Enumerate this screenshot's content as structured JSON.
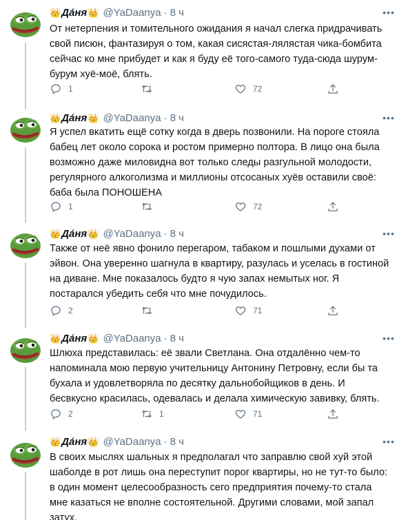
{
  "tweets": [
    {
      "name": "Да́ня",
      "handle": "@YaDaanya",
      "time": "8 ч",
      "crown_left": "👑",
      "crown_right": "👑",
      "more_icon": "ellipsis-icon",
      "text": "От нетерпения и томительного ожидания я начал слегка придрачивать\nсвой писюн, фантазируя о том, какая сисястая-лялястая чика-бомбита\nсейчас ко мне прибудет и как я буду её того-самого туда-сюда шурум-\nбурум хуё-моё, блять.",
      "replies": "1",
      "retweets": "",
      "likes": "72"
    },
    {
      "name": "Да́ня",
      "handle": "@YaDaanya",
      "time": "8 ч",
      "crown_left": "👑",
      "crown_right": "👑",
      "more_icon": "ellipsis-icon",
      "text": "Я успел вкатить ещё сотку когда в дверь позвонили. На пороге стояла\nбабец лет около сорока и ростом примерно полтора. В лицо она была\nвозможно даже миловидна вот только следы разгульной молодости,\nрегулярного алкоголизма и миллионы отсосаных хуёв оставили своё:\nбаба была ПОНОШЕНА",
      "replies": "1",
      "retweets": "",
      "likes": "72"
    },
    {
      "name": "Да́ня",
      "handle": "@YaDaanya",
      "time": "8 ч",
      "crown_left": "👑",
      "crown_right": "👑",
      "more_icon": "ellipsis-icon",
      "text": "Также от неё явно фонило перегаром, табаком и пошлыми духами от\nэйвон. Она уверенно шагнула в квартиру, разулась и уселась в гостиной\nна диване. Мне показалось будто я чую запах немытых ног. Я\nпостарался убедить себя что мне почудилось.",
      "replies": "2",
      "retweets": "",
      "likes": "71"
    },
    {
      "name": "Да́ня",
      "handle": "@YaDaanya",
      "time": "8 ч",
      "crown_left": "👑",
      "crown_right": "👑",
      "more_icon": "ellipsis-icon",
      "text": "Шлюха представилась: её звали Светлана. Она отдалённо чем-то\nнапоминала мою первую учительницу Антонину Петровну, если бы та\nбухала и удовлетворяла по десятку дальнобойщиков в день. И\nбесвкусно красилась, одевалась и делала химическую завивку, блять.",
      "replies": "2",
      "retweets": "1",
      "likes": "71"
    },
    {
      "name": "Да́ня",
      "handle": "@YaDaanya",
      "time": "8 ч",
      "crown_left": "👑",
      "crown_right": "👑",
      "more_icon": "ellipsis-icon",
      "text": "В своих мыслях шальных я предполагал что заправлю свой хуй этой\nшаболде в рот лишь она переступит порог квартиры, но не тут-то было:\nв один момент целесообразность сего предприятия почему-то стала\nмне казаться не вполне состоятельной. Другими словами, мой запал\nзатух.",
      "replies": "",
      "retweets": "",
      "likes": ""
    }
  ],
  "icons": {
    "reply": "reply-icon",
    "retweet": "retweet-icon",
    "like": "heart-icon",
    "share": "share-icon",
    "avatar": "pepe-frog-avatar"
  }
}
